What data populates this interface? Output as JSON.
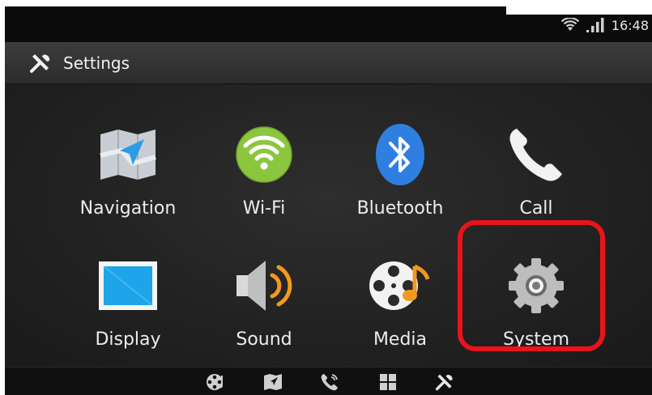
{
  "status_bar": {
    "time": "16:48",
    "icons": [
      "wifi-icon",
      "signal-icon"
    ]
  },
  "title_bar": {
    "icon": "tools-icon",
    "title": "Settings"
  },
  "menu": [
    {
      "id": "navigation",
      "label": "Navigation",
      "icon": "map-navigation-icon"
    },
    {
      "id": "wifi",
      "label": "Wi-Fi",
      "icon": "wifi-icon"
    },
    {
      "id": "bluetooth",
      "label": "Bluetooth",
      "icon": "bluetooth-icon"
    },
    {
      "id": "call",
      "label": "Call",
      "icon": "phone-icon"
    },
    {
      "id": "display",
      "label": "Display",
      "icon": "display-icon"
    },
    {
      "id": "sound",
      "label": "Sound",
      "icon": "speaker-icon"
    },
    {
      "id": "media",
      "label": "Media",
      "icon": "film-reel-music-icon"
    },
    {
      "id": "system",
      "label": "System",
      "icon": "gear-icon",
      "highlighted": true
    }
  ],
  "dock": [
    "media-icon",
    "map-icon",
    "phone-icon",
    "apps-grid-icon",
    "tools-icon"
  ],
  "colors": {
    "highlight": "#e8141b",
    "wifi_green": "#8cc63f",
    "bluetooth_blue": "#2f7fe0",
    "display_blue": "#1ea4e8"
  }
}
